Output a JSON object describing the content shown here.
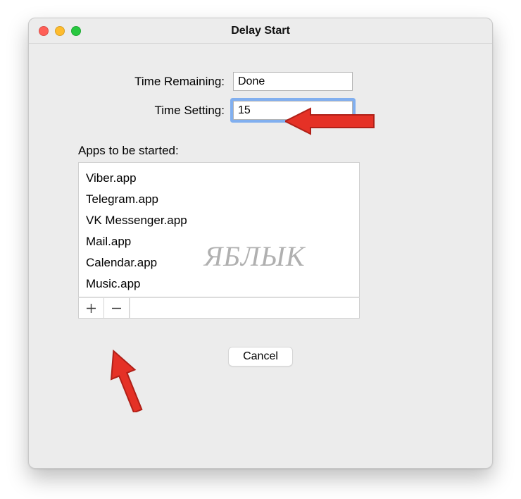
{
  "window": {
    "title": "Delay Start"
  },
  "fields": {
    "time_remaining_label": "Time Remaining:",
    "time_remaining_value": "Done",
    "time_setting_label": "Time Setting:",
    "time_setting_value": "15"
  },
  "apps": {
    "label": "Apps to be started:",
    "items": [
      "Viber.app",
      "Telegram.app",
      "VK Messenger.app",
      "Mail.app",
      "Calendar.app",
      "Music.app"
    ]
  },
  "buttons": {
    "cancel": "Cancel"
  },
  "watermark": "ЯБЛЫК",
  "annotation_color": "#e53126"
}
